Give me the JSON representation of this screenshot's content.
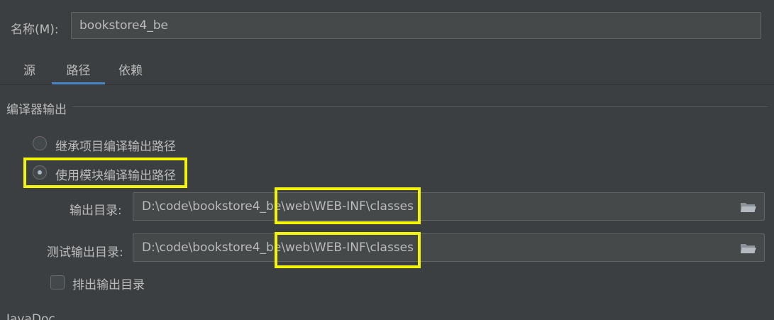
{
  "header": {
    "name_label": "名称(M):",
    "name_value": "bookstore4_be"
  },
  "tabs": [
    {
      "label": "源",
      "active": false
    },
    {
      "label": "路径",
      "active": true
    },
    {
      "label": "依赖",
      "active": false
    }
  ],
  "compiler_output": {
    "section_title": "编译器输出",
    "inherit_label": "继承项目编译输出路径",
    "module_label": "使用模块编译输出路径",
    "selected": "module",
    "output_dir_label": "输出目录:",
    "output_dir_value": "D:\\code\\bookstore4_be\\web\\WEB-INF\\classes",
    "test_output_dir_label": "测试输出目录:",
    "test_output_dir_value": "D:\\code\\bookstore4_be\\web\\WEB-INF\\classes",
    "exclude_label": "排出输出目录",
    "exclude_checked": false
  },
  "next_section": {
    "title": "JavaDoc"
  },
  "colors": {
    "background": "#3c3f41",
    "accent": "#4a88c7",
    "highlight": "#f4f40a"
  }
}
